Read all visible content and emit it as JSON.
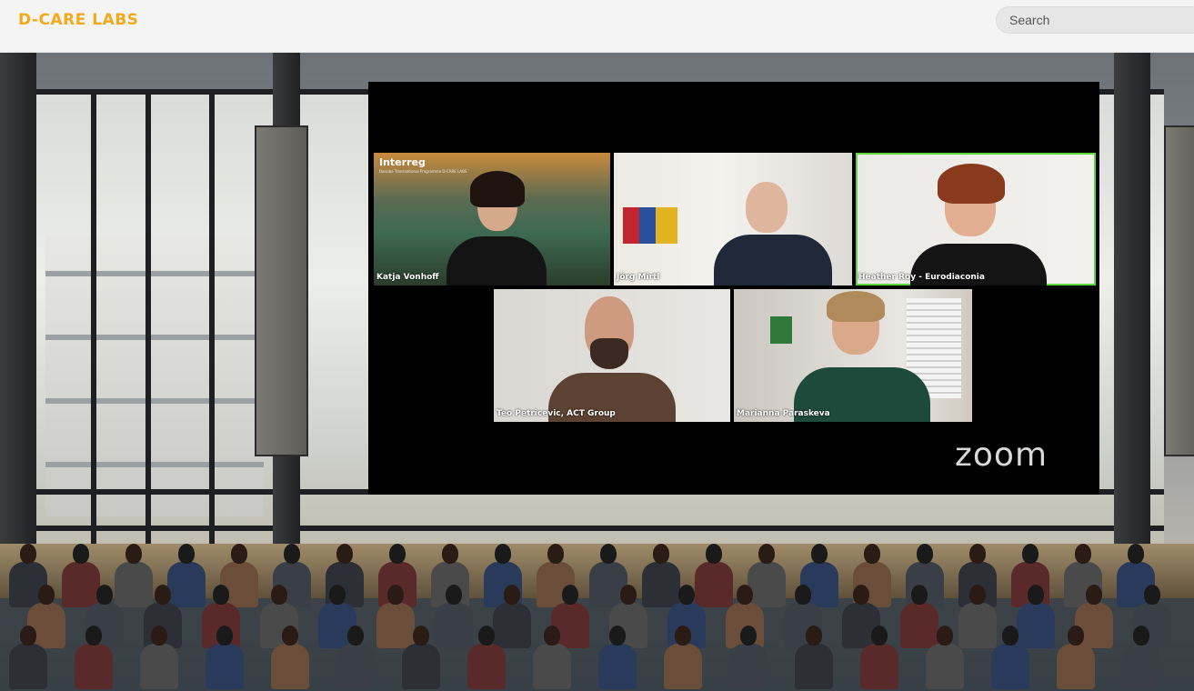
{
  "header": {
    "brand": "D-CARE LABS",
    "search_placeholder": "Search"
  },
  "meeting": {
    "logo": "zoom",
    "active_speaker_color": "#5fd63b",
    "participants": [
      {
        "name": "Katja Vonhoff",
        "active": false
      },
      {
        "name": "Jörg Mirtl",
        "active": false
      },
      {
        "name": "Heather Roy - Eurodiaconia",
        "active": true
      },
      {
        "name": "Teo Petricevic, ACT Group",
        "active": false
      },
      {
        "name": "Marianna Paraskeva",
        "active": false
      }
    ],
    "virtual_background_text": {
      "title": "Interreg",
      "subtitle": "Danube Transnational Programme D-CARE LABS"
    }
  },
  "colors": {
    "brand": "#f3a91b",
    "header_bg": "#f4f4f4"
  }
}
